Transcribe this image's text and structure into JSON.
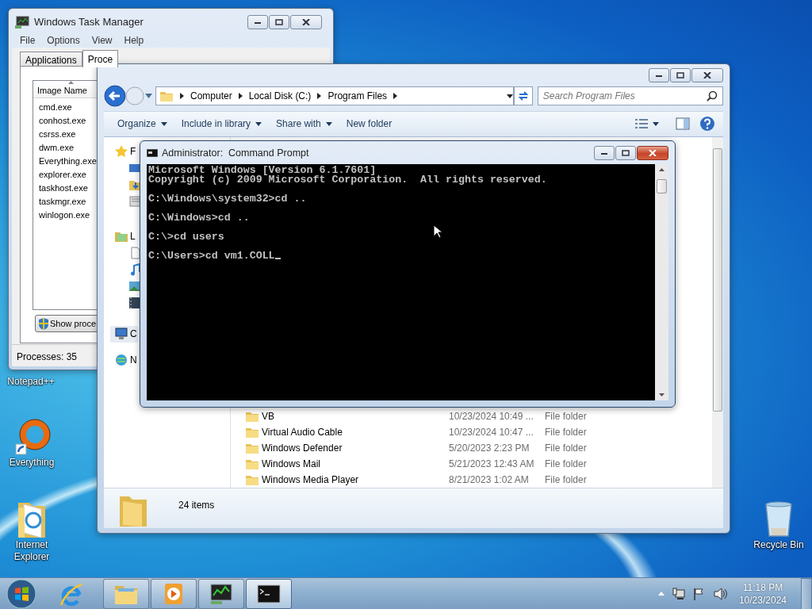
{
  "desktop_icons": [
    {
      "label": "Notepad++",
      "kind": "hidden"
    },
    {
      "label": "Everything",
      "kind": "ring"
    },
    {
      "label": "Internet Explorer",
      "kind": "folder"
    },
    {
      "label": "Recycle Bin",
      "kind": "bin"
    }
  ],
  "task_manager": {
    "title": "Windows Task Manager",
    "menu": [
      "File",
      "Options",
      "View",
      "Help"
    ],
    "tabs": [
      {
        "label": "Applications",
        "selected": false
      },
      {
        "label": "Proce",
        "selected": true
      }
    ],
    "column": "Image Name",
    "processes": [
      "cmd.exe",
      "conhost.exe",
      "csrss.exe",
      "dwm.exe",
      "Everything.exe",
      "explorer.exe",
      "taskhost.exe",
      "taskmgr.exe",
      "winlogon.exe"
    ],
    "button": "Show proce",
    "status": "Processes: 35"
  },
  "explorer": {
    "breadcrumb": [
      "Computer",
      "Local Disk (C:)",
      "Program Files"
    ],
    "search_placeholder": "Search Program Files",
    "toolbar": [
      {
        "label": "Organize",
        "dropdown": true
      },
      {
        "label": "Include in library",
        "dropdown": true
      },
      {
        "label": "Share with",
        "dropdown": true
      },
      {
        "label": "New folder",
        "dropdown": false
      }
    ],
    "nav": [
      {
        "label": "F",
        "kind": "favorites",
        "selected": false
      },
      {
        "label": "L",
        "kind": "libraries",
        "selected": false
      },
      {
        "label": "C",
        "kind": "computer",
        "selected": true
      },
      {
        "label": "N",
        "kind": "network",
        "selected": false
      }
    ],
    "files": [
      {
        "name": "VB",
        "date": "10/23/2024 10:49 ...",
        "type": "File folder"
      },
      {
        "name": "Virtual Audio Cable",
        "date": "10/23/2024 10:47 ...",
        "type": "File folder"
      },
      {
        "name": "Windows Defender",
        "date": "5/20/2023 2:23 PM",
        "type": "File folder"
      },
      {
        "name": "Windows Mail",
        "date": "5/21/2023 12:43 AM",
        "type": "File folder"
      },
      {
        "name": "Windows Media Player",
        "date": "8/21/2023 1:02 AM",
        "type": "File folder"
      }
    ],
    "status": "24 items"
  },
  "command_prompt": {
    "title": "Administrator:  Command Prompt",
    "blocks": [
      [
        "Microsoft Windows [Version 6.1.7601]",
        "Copyright (c) 2009 Microsoft Corporation.  All rights reserved."
      ],
      [
        "C:\\Windows\\system32>cd .."
      ],
      [
        "C:\\Windows>cd .."
      ],
      [
        "C:\\>cd users"
      ],
      [
        "C:\\Users>cd vm1.COLL"
      ]
    ],
    "text_cursor": true
  },
  "taskbar": {
    "items": [
      {
        "kind": "ie",
        "running": false,
        "selected": false
      },
      {
        "kind": "explorer",
        "running": true,
        "selected": false
      },
      {
        "kind": "media",
        "running": true,
        "selected": false
      },
      {
        "kind": "taskmgr",
        "running": true,
        "selected": false
      },
      {
        "kind": "cmd",
        "running": true,
        "selected": true
      }
    ],
    "time": "11:18 PM",
    "date": "10/23/2024"
  }
}
